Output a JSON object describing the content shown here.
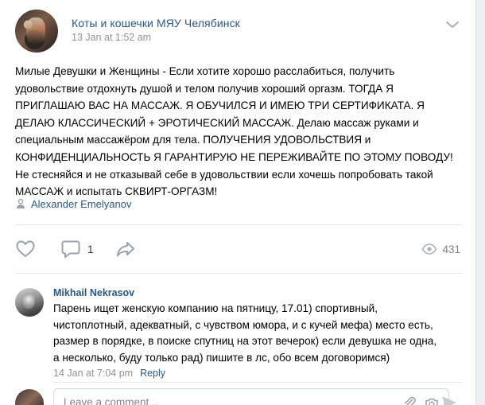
{
  "post": {
    "group_name": "Коты и кошечки МЯУ Челябинск",
    "time": "13 Jan at 1:52 am",
    "text_lines": [
      "Милые Девушки и Женщины - Если хотите хорошо расслабиться, получить",
      "удовольствие отдохнуть душой и телом получив хороший оргазм. ТОГДА Я",
      "ПРИГЛАШАЮ ВАС НА МАССАЖ. Я ОБУЧИЛСЯ И ИМЕЮ ТРИ СЕРТИФИКАТА. Я",
      "ДЕЛАЮ КЛАССИЧЕСКИЙ + ЭРОТИЧЕСКИЙ МАССАЖ. Делаю массаж руками и",
      "специальным массажёром для тела. ПОЛУЧЕНИЯ УДОВОЛЬСТВИЯ и",
      "КОНФИДЕНЦИАЛЬНОСТЬ Я ГАРАНТИРУЮ НЕ ПЕРЕЖИВАЙТЕ ПО ЭТОМУ ПОВОДУ!",
      "Не стесняйся и не отказывай себе в удовольствии если хочешь попробовать такой",
      "МАССАЖ и испытать СКВИРТ-ОРГАЗМ!"
    ],
    "author": "Alexander Emelyanov",
    "comments_count": "1",
    "views_count": "431"
  },
  "comment": {
    "author": "Mikhail Nekrasov",
    "text_lines": [
      "Парень ищет женскую компанию на пятницу, 17.01) спортивный,",
      "чистоплотный, адекватный, с чувством юмора, и с кучей мефа) место есть,",
      "размер в порядке, в поиске спутниц на этот вечерок) если девушка не одна,",
      "а несколько, буду только рад) пишите в лс, обо всем договоримся)"
    ],
    "time": "14 Jan at 7:04 pm",
    "reply_label": "Reply"
  },
  "reply_box": {
    "placeholder": "Leave a comment..."
  },
  "icons": {
    "chevron": "chevron-down-icon",
    "author": "person-icon",
    "like": "heart-icon",
    "comment": "comment-icon",
    "share": "share-icon",
    "views": "eye-icon",
    "attach": "paperclip-icon",
    "camera": "camera-icon",
    "send": "send-icon"
  },
  "colors": {
    "link": "#2a5885",
    "muted": "#939393",
    "icon": "#99a2ad",
    "background": "#edeef0"
  }
}
